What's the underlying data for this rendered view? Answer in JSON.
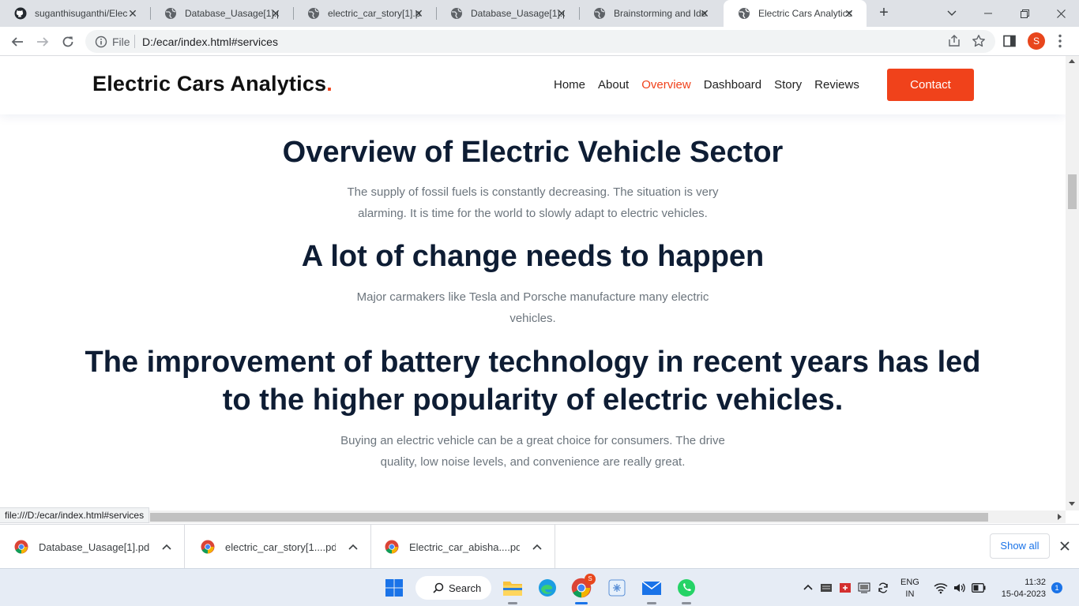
{
  "browser": {
    "tabs": [
      {
        "title": "suganthisuganthi/Elec",
        "icon": "github-icon"
      },
      {
        "title": "Database_Uasage[1].p",
        "icon": "globe-icon"
      },
      {
        "title": "electric_car_story[1].pc",
        "icon": "globe-icon"
      },
      {
        "title": "Database_Uasage[1].p",
        "icon": "globe-icon"
      },
      {
        "title": "Brainstorming and Ide",
        "icon": "globe-icon"
      },
      {
        "title": "Electric Cars Analytics",
        "icon": "globe-icon",
        "active": true
      }
    ],
    "omnibox": {
      "scheme_label": "File",
      "url": "D:/ecar/index.html#services"
    },
    "profile_initial": "S",
    "status_url": "file:///D:/ecar/index.html#services"
  },
  "site": {
    "logo": "Electric Cars Analytics",
    "logo_dot": ".",
    "nav": [
      "Home",
      "About",
      "Overview",
      "Dashboard",
      "Story",
      "Reviews"
    ],
    "active_nav": "Overview",
    "contact": "Contact",
    "accent_color": "#f0421b"
  },
  "content": {
    "sections": [
      {
        "heading": "Overview of Electric Vehicle Sector",
        "text_line1": "The supply of fossil fuels is constantly decreasing. The situation is very",
        "text_line2": "alarming. It is time for the world to slowly adapt to electric vehicles."
      },
      {
        "heading": "A lot of change needs to happen",
        "text_line1": "Major carmakers like Tesla and Porsche manufacture many electric",
        "text_line2": "vehicles."
      },
      {
        "heading_line1": "The improvement of battery technology in recent years has led",
        "heading_line2": "to the higher popularity of electric vehicles.",
        "text_line1": "Buying an electric vehicle can be a great choice for consumers. The drive",
        "text_line2": "quality, low noise levels, and convenience are really great."
      }
    ]
  },
  "downloads": {
    "items": [
      "Database_Uasage[1].pdf",
      "electric_car_story[1....pdf",
      "Electric_car_abisha....pdf"
    ],
    "show_all": "Show all"
  },
  "taskbar": {
    "search_label": "Search",
    "lang_line1": "ENG",
    "lang_line2": "IN",
    "time": "11:32",
    "date": "15-04-2023",
    "notification_count": "1",
    "chrome_badge": "S"
  }
}
